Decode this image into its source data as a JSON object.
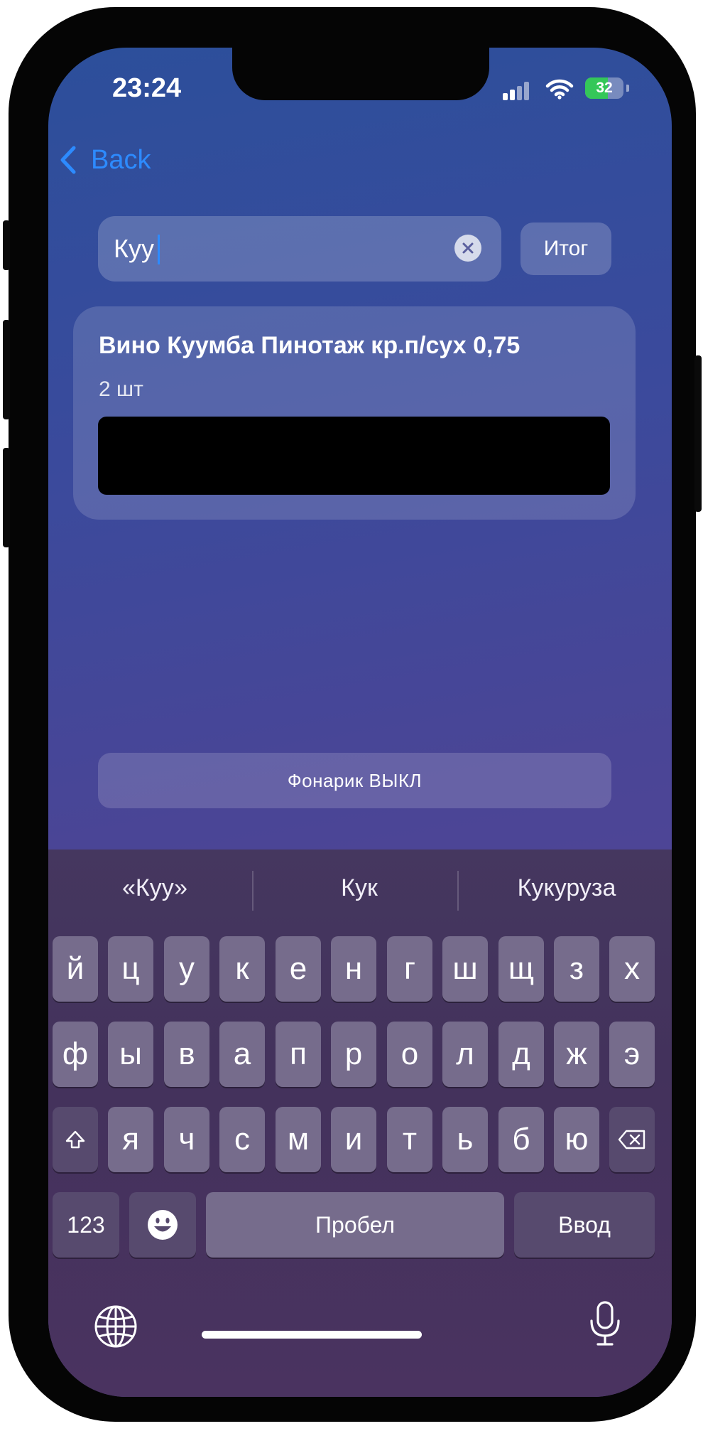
{
  "status_bar": {
    "time": "23:24",
    "battery": "32"
  },
  "nav": {
    "back_label": "Back"
  },
  "search": {
    "value": "Куу",
    "total_button": "Итог"
  },
  "result": {
    "title": "Вино Куумба Пинотаж кр.п/сух 0,75",
    "quantity": "2 шт"
  },
  "torch_button": "Фонарик ВЫКЛ",
  "keyboard": {
    "suggestions": [
      "«Куу»",
      "Кук",
      "Кукуруза"
    ],
    "row1": [
      "й",
      "ц",
      "у",
      "к",
      "е",
      "н",
      "г",
      "ш",
      "щ",
      "з",
      "х"
    ],
    "row2": [
      "ф",
      "ы",
      "в",
      "а",
      "п",
      "р",
      "о",
      "л",
      "д",
      "ж",
      "э"
    ],
    "row3": [
      "я",
      "ч",
      "с",
      "м",
      "и",
      "т",
      "ь",
      "б",
      "ю"
    ],
    "numbers_key": "123",
    "space_key": "Пробел",
    "return_key": "Ввод"
  },
  "colors": {
    "accent": "#2d8bff",
    "battery_green": "#34c759"
  }
}
